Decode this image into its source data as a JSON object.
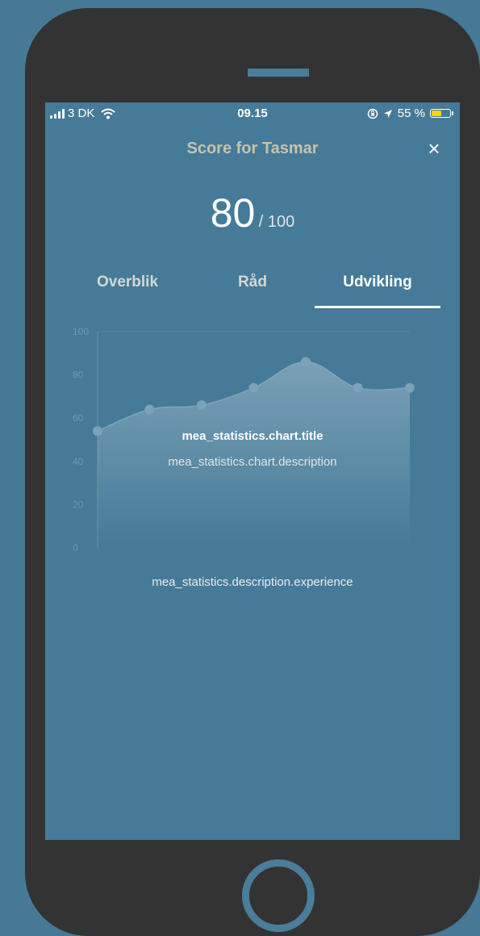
{
  "status_bar": {
    "carrier": "3 DK",
    "time": "09.15",
    "battery_percent": "55 %",
    "battery_level": 0.55,
    "battery_color": "#ffd400"
  },
  "header": {
    "title": "Score for Tasmar",
    "close_icon": "×"
  },
  "score": {
    "value": "80",
    "max": "/ 100"
  },
  "tabs": [
    {
      "label": "Overblik",
      "active": false
    },
    {
      "label": "Råd",
      "active": false
    },
    {
      "label": "Udvikling",
      "active": true
    }
  ],
  "chart_data": {
    "type": "area",
    "y_ticks": [
      "100",
      "80",
      "60",
      "40",
      "20",
      "0"
    ],
    "ylim": [
      0,
      100
    ],
    "values": [
      54,
      64,
      66,
      74,
      86,
      74,
      74
    ],
    "title": "mea_statistics.chart.title",
    "description": "mea_statistics.chart.description",
    "grid": false
  },
  "description_experience": "mea_statistics.description.experience",
  "colors": {
    "background": "#467996",
    "screen": "#457b99",
    "phone_frame": "#333333",
    "title": "#c8c2a8"
  }
}
